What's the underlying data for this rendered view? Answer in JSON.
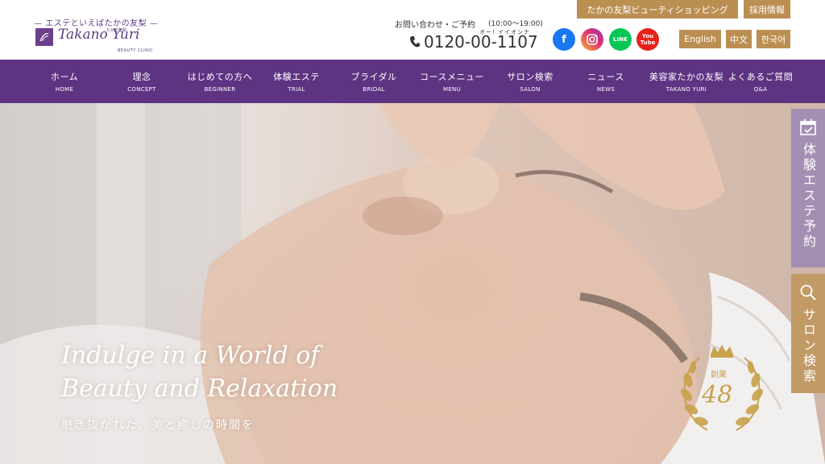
{
  "header": {
    "logo": {
      "tagline": "エステといえばたかの友梨",
      "name": "Takano Yuri",
      "name_small": "たかの友梨",
      "sub": "BEAUTY CLINIC"
    },
    "contact": {
      "label": "お問い合わせ・ご予約",
      "hours": "(10:00〜19:00)",
      "phone_ruby": "オー! イイオンナ",
      "phone": "0120-00-1107"
    },
    "social": {
      "facebook": "f",
      "instagram": "",
      "line": "LINE",
      "youtube": "You Tube"
    },
    "shop_button": "たかの友梨ビューティショッピング",
    "recruit_button": "採用情報",
    "languages": [
      "English",
      "中文",
      "한국어"
    ]
  },
  "nav": {
    "items": [
      {
        "jp": "ホーム",
        "en": "HOME"
      },
      {
        "jp": "理念",
        "en": "CONCEPT"
      },
      {
        "jp": "はじめての方へ",
        "en": "BEGINNER"
      },
      {
        "jp": "体験エステ",
        "en": "TRIAL"
      },
      {
        "jp": "ブライダル",
        "en": "BRIDAL"
      },
      {
        "jp": "コースメニュー",
        "en": "MENU"
      },
      {
        "jp": "サロン検索",
        "en": "SALON"
      },
      {
        "jp": "ニュース",
        "en": "NEWS"
      },
      {
        "jp": "美容家たかの友梨",
        "en": "TAKANO YURI"
      },
      {
        "jp": "よくあるご質問",
        "en": "Q&A"
      }
    ]
  },
  "hero": {
    "title_line1": "Indulge in a World of",
    "title_line2": "Beauty and Relaxation",
    "subtitle": "磨き抜かれた、美と癒しの時間を",
    "badge": {
      "founded": "創業",
      "years": "48"
    }
  },
  "side": {
    "trial": "体験エステ予約",
    "salon": "サロン検索"
  },
  "colors": {
    "nav_bg": "#5e3382",
    "gold": "#bb8f52",
    "side_trial": "#a48fb3",
    "side_salon": "#c19a66"
  },
  "icons": {
    "phone": "phone-icon",
    "calendar": "calendar-icon",
    "search": "search-icon",
    "crown": "crown-icon"
  }
}
